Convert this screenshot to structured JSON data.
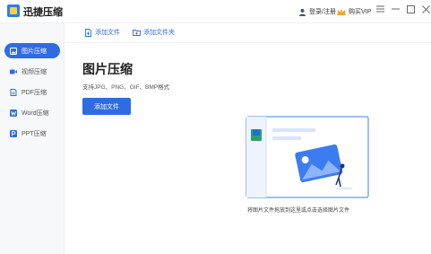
{
  "app": {
    "title": "迅捷压缩"
  },
  "header": {
    "user_label": "登录/注册",
    "vip_label": "购买VIP",
    "icons": {
      "user": "user-icon",
      "vip": "crown-icon"
    },
    "window_controls": [
      "menu-icon",
      "minimize-icon",
      "maximize-icon",
      "close-icon"
    ]
  },
  "sidebar": {
    "items": [
      {
        "label": "图片压缩",
        "icon": "image-icon",
        "active": true
      },
      {
        "label": "视频压缩",
        "icon": "video-icon",
        "active": false
      },
      {
        "label": "PDF压缩",
        "icon": "pdf-icon",
        "active": false
      },
      {
        "label": "Word压缩",
        "icon": "word-icon",
        "active": false
      },
      {
        "label": "PPT压缩",
        "icon": "ppt-icon",
        "active": false
      }
    ]
  },
  "toolbar": {
    "add_file": "添加文件",
    "add_folder": "添加文件夹",
    "icons": {
      "add_file": "add-file-icon",
      "add_folder": "add-folder-icon"
    }
  },
  "main": {
    "title": "图片压缩",
    "subtitle": "支持JPG、PNG、GIF、BMP格式",
    "add_button": "添加文件",
    "drop_hint": "将图片文件拖放到这里或点击选择图片文件"
  },
  "colors": {
    "accent": "#2f6ce4",
    "illustration_blue": "#3b7cf0",
    "illustration_light": "#e8f0fe"
  }
}
